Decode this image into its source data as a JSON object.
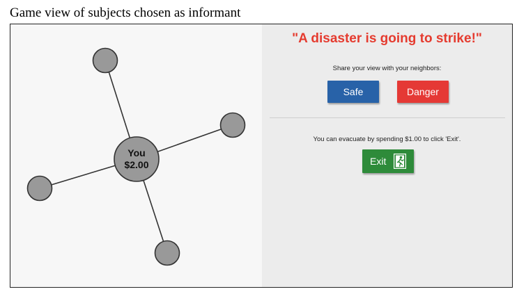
{
  "caption": "Game view of subjects chosen as informant",
  "network": {
    "center_label": "You",
    "center_amount": "$2.00",
    "neighbor_count": 4
  },
  "panel": {
    "headline": "\"A disaster is going to strike!\"",
    "share_prompt": "Share your view with your neighbors:",
    "safe_label": "Safe",
    "danger_label": "Danger",
    "evacuate_info": "You can evacuate by spending $1.00 to click 'Exit'.",
    "exit_label": "Exit"
  },
  "colors": {
    "headline": "#e53b2f",
    "safe": "#2862a8",
    "danger": "#e53935",
    "exit": "#2e8b3a",
    "node": "#999999"
  },
  "icons": {
    "exit": "running-person-exit-icon"
  }
}
